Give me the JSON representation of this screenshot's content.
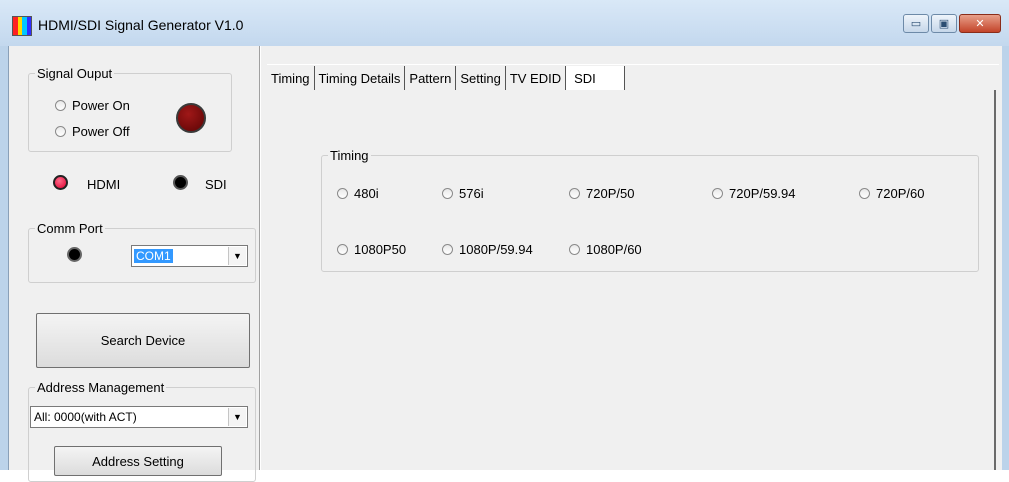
{
  "window": {
    "title": "HDMI/SDI Signal Generator V1.0",
    "controls": {
      "minimize": "▭",
      "maximize": "▣",
      "close": "✕"
    }
  },
  "colors": {
    "power_led": "#7a0a0a",
    "hdmi_led": "#ff1f4f",
    "sdi_led": "#000000",
    "comm_led": "#000000"
  },
  "signal_output": {
    "legend": "Signal Ouput",
    "power_on": "Power On",
    "power_off": "Power Off"
  },
  "mode": {
    "hdmi": "HDMI",
    "sdi": "SDI"
  },
  "comm_port": {
    "legend": "Comm Port",
    "selected": "COM1"
  },
  "search_button": "Search Device",
  "address_management": {
    "legend": "Address Management",
    "selected": "All: 0000(with ACT)",
    "setting_button": "Address Setting"
  },
  "tabs": [
    {
      "label": "Timing"
    },
    {
      "label": "Timing Details"
    },
    {
      "label": "Pattern"
    },
    {
      "label": "Setting"
    },
    {
      "label": "TV EDID"
    },
    {
      "label": "SDI"
    }
  ],
  "sdi_panel": {
    "timing_legend": "Timing",
    "options_row1": [
      "480i",
      "576i",
      "720P/50",
      "720P/59.94",
      "720P/60"
    ],
    "options_row2": [
      "1080P50",
      "1080P/59.94",
      "1080P/60"
    ]
  }
}
